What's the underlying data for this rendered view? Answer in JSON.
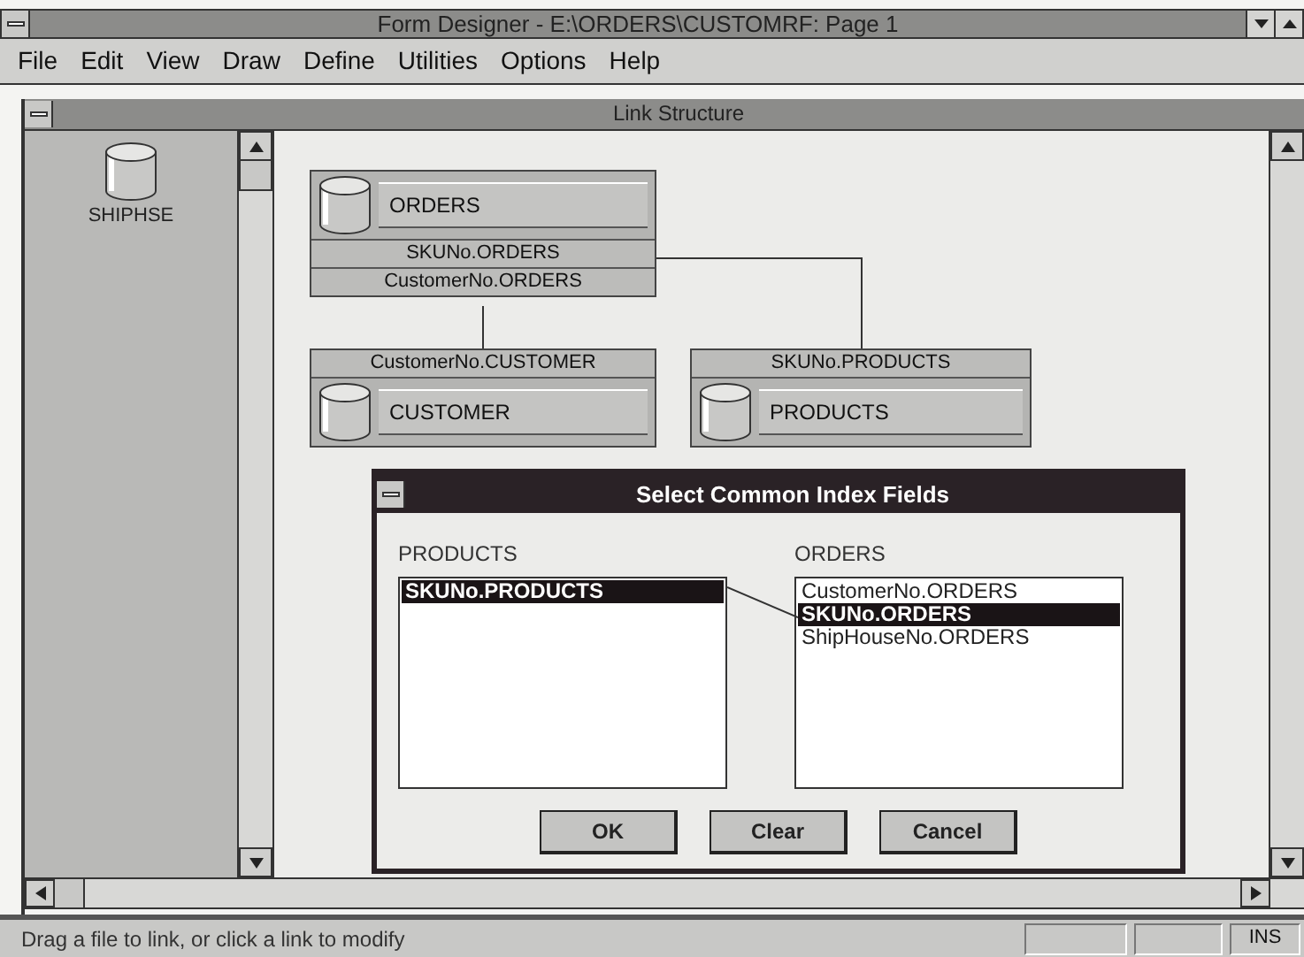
{
  "window": {
    "title": "Form Designer - E:\\ORDERS\\CUSTOMRF: Page 1"
  },
  "menu": [
    "File",
    "Edit",
    "View",
    "Draw",
    "Define",
    "Utilities",
    "Options",
    "Help"
  ],
  "child_window": {
    "title": "Link Structure"
  },
  "palette": [
    {
      "label": "SHIPHSE"
    }
  ],
  "tables": [
    {
      "name": "ORDERS",
      "kind": "name-top",
      "fields": [
        "SKUNo.ORDERS",
        "CustomerNo.ORDERS"
      ]
    },
    {
      "name": "CUSTOMER",
      "kind": "name-bottom",
      "fields": [
        "CustomerNo.CUSTOMER"
      ]
    },
    {
      "name": "PRODUCTS",
      "kind": "name-bottom",
      "fields": [
        "SKUNo.PRODUCTS"
      ]
    }
  ],
  "dialog": {
    "title": "Select Common Index Fields",
    "lists": [
      {
        "label": "PRODUCTS",
        "items": [
          {
            "text": "SKUNo.PRODUCTS",
            "selected": true
          }
        ]
      },
      {
        "label": "ORDERS",
        "items": [
          {
            "text": "CustomerNo.ORDERS",
            "selected": false
          },
          {
            "text": "SKUNo.ORDERS",
            "selected": true
          },
          {
            "text": "ShipHouseNo.ORDERS",
            "selected": false
          }
        ]
      }
    ],
    "buttons": [
      "OK",
      "Clear",
      "Cancel"
    ]
  },
  "status_bar": {
    "message": "Drag a file to link, or click a link to modify",
    "indicator": "INS"
  }
}
